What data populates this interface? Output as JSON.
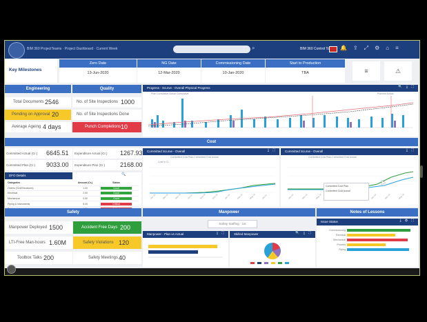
{
  "topbar": {
    "title": "BIM 360 ProjectTeams · Project Dashboard · Current Week",
    "user": "BIM 360 Control Tower",
    "icons": [
      "bell-icon",
      "share-icon",
      "fullscreen-icon",
      "settings-icon",
      "home-icon",
      "menu-icon"
    ]
  },
  "milestones": {
    "label": "Key Milestones",
    "columns": [
      {
        "head": "Zero Date",
        "value": "13-Jun-2020"
      },
      {
        "head": "NG Date",
        "value": "12-Mar-2020"
      },
      {
        "head": "Commissioning Date",
        "value": "10-Jan-2020"
      },
      {
        "head": "Start to Production",
        "value": "TBA"
      }
    ],
    "buttons": [
      "≡",
      "⚠"
    ]
  },
  "engineering": {
    "title": "Engineering",
    "items": [
      {
        "label": "Total Documents",
        "value": "2546"
      },
      {
        "label": "Pending on Approval",
        "value": "20"
      },
      {
        "label": "Average Ageing",
        "value": "4 days"
      }
    ]
  },
  "quality": {
    "title": "Quality",
    "items": [
      {
        "label": "No. of Site Inspections",
        "value": "1000"
      },
      {
        "label": "No. of Site Inspections Done",
        "value": ""
      },
      {
        "label": "Punch Completions",
        "value": "10"
      }
    ]
  },
  "progress_widget": {
    "title": "Progress - Scurve - Overall Physical Progress",
    "legend_left": "Plan Cumulative  Actual Cumulative",
    "legend_right": "Planned  Actual"
  },
  "cost_title": "Cost",
  "cost": {
    "items": [
      {
        "label": "Committed Actual (Cr.)",
        "value": "6645.51"
      },
      {
        "label": "Expenditure Actual (Cr.)",
        "value": "1267.93"
      },
      {
        "label": "Committed Plan (Cr.)",
        "value": "9033.00"
      },
      {
        "label": "Expenditure Plan (Cr.)",
        "value": "2168.00"
      }
    ]
  },
  "dfo": {
    "title": "DFO Details",
    "header": [
      "Categories",
      "Amount (Cr.)",
      "Status"
    ],
    "rows": [
      {
        "c1": "Orders (Civil/Structures)",
        "c2": "1.00",
        "c3": "Good"
      },
      {
        "c1": "Electrical",
        "c2": "2.00",
        "c3": "Good"
      },
      {
        "c1": "Mechanical",
        "c2": "0.00",
        "c3": "Good"
      },
      {
        "c1": "Piping & Instruments",
        "c2": "5.00",
        "c3": "Critical"
      },
      {
        "c1": "Equipment",
        "c2": "1.00",
        "c3": "Critical"
      }
    ]
  },
  "scurve_committed": {
    "title": "Committed Scurve - Overall",
    "legend": "Committed Cost Plan  Committed Cost Actual",
    "ylabel": "Cost in Cr."
  },
  "scurve_overall": {
    "title": "Committed Scurve - Overall",
    "legend": "Committed Cost Plan  Committed Cost Actual",
    "tooltip_line1": "Committed Cost Plan",
    "tooltip_line2": "Committed Cost Actual"
  },
  "safety": {
    "title": "Safety",
    "items": [
      {
        "label": "Manpower Deployed",
        "value": "1500"
      },
      {
        "label": "Accident Free Days",
        "value": "200"
      },
      {
        "label": "LTI-Free Man-hours",
        "value": "1.60M"
      },
      {
        "label": "Safety Violations",
        "value": "120"
      },
      {
        "label": "Toolbox Talks",
        "value": "200"
      },
      {
        "label": "Safety Meetings",
        "value": "40"
      }
    ]
  },
  "manpower": {
    "title": "Manpower",
    "select": "Safety Staffing · 1st",
    "w1_title": "Manpower - Plan vs Actual",
    "w2_title": "Skilled Manpower"
  },
  "lessons": {
    "title": "Notes of Lessons",
    "w_title": "Issue Status",
    "categories": [
      "Commissioning",
      "Electrical",
      "Mechanical",
      "Process",
      "Piping"
    ]
  },
  "colors": {
    "navy": "#1d3f7d",
    "blue": "#3b6fc4",
    "yellow": "#f6c928",
    "red": "#e23b48",
    "green": "#2f9e3d"
  }
}
